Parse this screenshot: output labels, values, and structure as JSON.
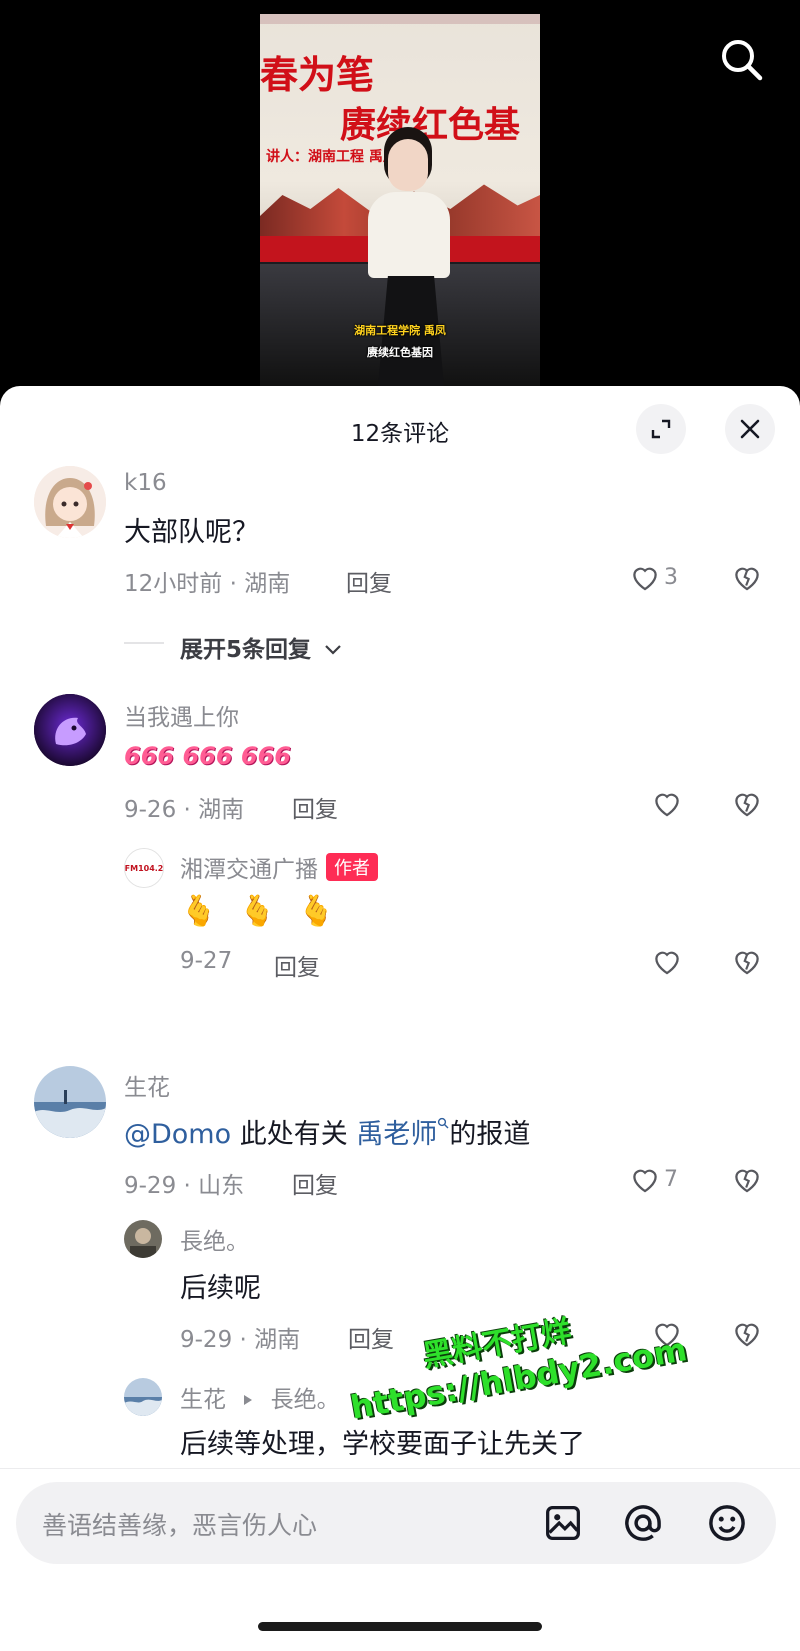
{
  "video": {
    "banner_line1": "春为笔",
    "banner_line2": "赓续红色基",
    "banner_line3": "讲人：湖南工程 禹凤",
    "caption_name": "湖南工程学院 禹凤",
    "caption_topic": "赓续红色基因"
  },
  "sheet": {
    "title": "12条评论"
  },
  "comments": [
    {
      "user": "k16",
      "text": "大部队呢？",
      "meta": "12小时前 · 湖南",
      "reply_label": "回复",
      "likes": "3",
      "expand_label": "展开5条回复"
    },
    {
      "user": "当我遇上你",
      "text": "666 666 666",
      "meta": "9-26 · 湖南",
      "reply_label": "回复",
      "likes": "",
      "replies": [
        {
          "user": "湘潭交通广播",
          "badge": "作者",
          "avatar_text": "FM104.2",
          "text": "🫰 🫰 🫰",
          "meta": "9-27",
          "reply_label": "回复",
          "likes": ""
        }
      ]
    },
    {
      "user": "生花",
      "mention": "@Domo",
      "text_mid": "此处有关",
      "link": "禹老师",
      "text_end": "的报道",
      "meta": "9-29 · 山东",
      "reply_label": "回复",
      "likes": "7",
      "replies": [
        {
          "user": "長绝。",
          "text": "后续呢",
          "meta": "9-29 · 湖南",
          "reply_label": "回复",
          "likes": ""
        },
        {
          "user": "生花",
          "reply_to": "長绝。",
          "text": "后续等处理，学校要面子让先关了"
        }
      ]
    }
  ],
  "input": {
    "placeholder": "善语结善缘，恶言伤人心"
  },
  "watermark": {
    "line1": "黑料不打烊",
    "line2": "https://hlbdy2.com"
  },
  "colors": {
    "accent": "#fe2c55",
    "link": "#2f5f9e",
    "watermark": "#2ee02b"
  }
}
